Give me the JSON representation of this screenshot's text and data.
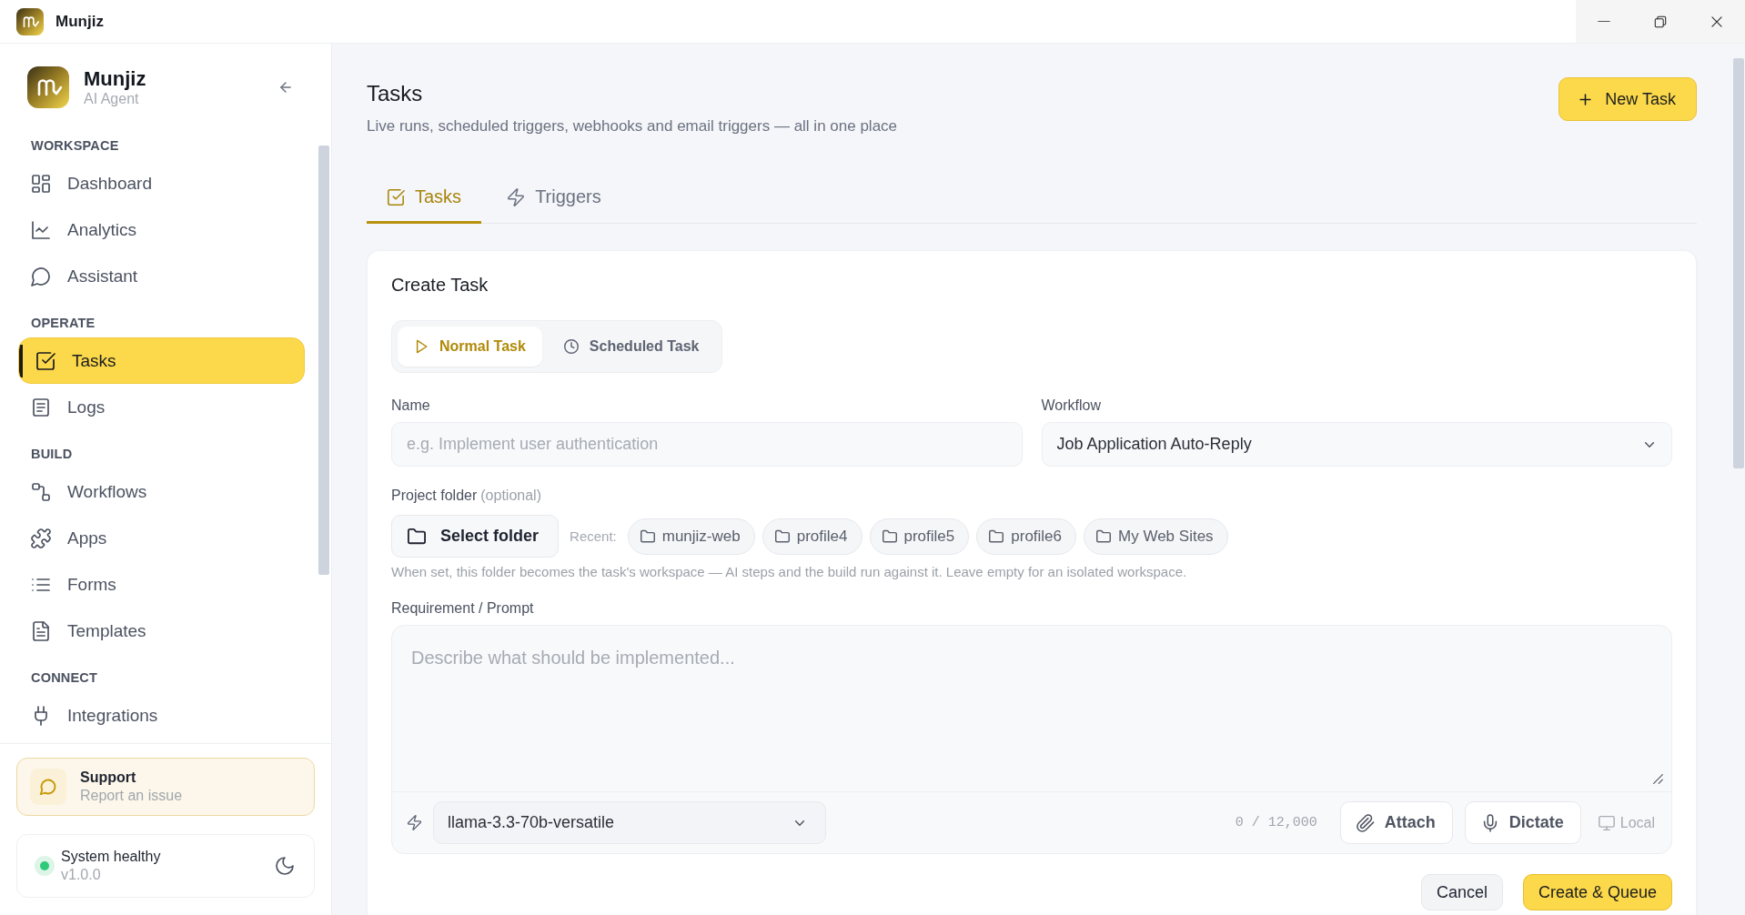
{
  "titlebar": {
    "app_name": "Munjiz"
  },
  "sidebar": {
    "brand": {
      "name": "Munjiz",
      "tagline": "AI Agent"
    },
    "sections": [
      {
        "label": "WORKSPACE",
        "items": [
          {
            "label": "Dashboard",
            "selected": false
          },
          {
            "label": "Analytics",
            "selected": false
          },
          {
            "label": "Assistant",
            "selected": false
          }
        ]
      },
      {
        "label": "OPERATE",
        "items": [
          {
            "label": "Tasks",
            "selected": true
          },
          {
            "label": "Logs",
            "selected": false
          }
        ]
      },
      {
        "label": "BUILD",
        "items": [
          {
            "label": "Workflows",
            "selected": false
          },
          {
            "label": "Apps",
            "selected": false
          },
          {
            "label": "Forms",
            "selected": false
          },
          {
            "label": "Templates",
            "selected": false
          }
        ]
      },
      {
        "label": "CONNECT",
        "items": [
          {
            "label": "Integrations",
            "selected": false
          }
        ]
      }
    ],
    "support": {
      "title": "Support",
      "subtitle": "Report an issue"
    },
    "status": {
      "label": "System healthy",
      "version": "v1.0.0",
      "healthy": true
    }
  },
  "header": {
    "title": "Tasks",
    "subtitle": "Live runs, scheduled triggers, webhooks and email triggers — all in one place",
    "action": "New Task"
  },
  "tabs": [
    {
      "label": "Tasks",
      "selected": true
    },
    {
      "label": "Triggers",
      "selected": false
    }
  ],
  "create_task": {
    "title": "Create Task",
    "task_types": [
      {
        "label": "Normal Task",
        "selected": true
      },
      {
        "label": "Scheduled Task",
        "selected": false
      }
    ],
    "name": {
      "label": "Name",
      "placeholder": "e.g. Implement user authentication"
    },
    "workflow": {
      "label": "Workflow",
      "value": "Job Application Auto-Reply"
    },
    "project_folder": {
      "label": "Project folder",
      "hint": "(optional)",
      "button": "Select folder",
      "recent_label": "Recent:",
      "recent": [
        "munjiz-web",
        "profile4",
        "profile5",
        "profile6",
        "My Web Sites"
      ],
      "help": "When set, this folder becomes the task's workspace — AI steps and the build run against it. Leave empty for an isolated workspace."
    },
    "prompt": {
      "label": "Requirement / Prompt",
      "placeholder": "Describe what should be implemented...",
      "model": "llama-3.3-70b-versatile",
      "char_count": "0 / 12,000",
      "actions": [
        {
          "label": "Attach",
          "disabled": false
        },
        {
          "label": "Dictate",
          "disabled": false
        },
        {
          "label": "Local",
          "disabled": true
        }
      ]
    },
    "buttons": [
      {
        "label": "Cancel",
        "kind": "secondary"
      },
      {
        "label": "Create & Queue",
        "kind": "primary"
      }
    ]
  }
}
